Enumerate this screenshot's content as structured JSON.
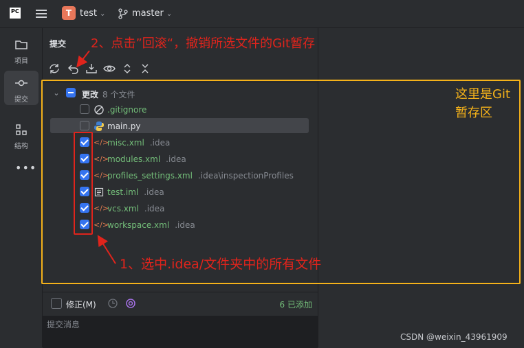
{
  "header": {
    "logo_text": "PC",
    "project_initial": "T",
    "project_name": "test",
    "branch_name": "master"
  },
  "leftbar": {
    "items": [
      {
        "label": "项目"
      },
      {
        "label": "提交"
      },
      {
        "label": "结构"
      }
    ],
    "more": "•••"
  },
  "panel": {
    "title": "提交",
    "group_label": "更改",
    "group_count": "8 个文件",
    "files": [
      {
        "name": ".gitignore",
        "path": "",
        "checked": false,
        "icon": "gitignore-icon"
      },
      {
        "name": "main.py",
        "path": "",
        "checked": false,
        "icon": "python-icon"
      },
      {
        "name": "misc.xml",
        "path": ".idea",
        "checked": true,
        "icon": "xml-icon"
      },
      {
        "name": "modules.xml",
        "path": ".idea",
        "checked": true,
        "icon": "xml-icon"
      },
      {
        "name": "profiles_settings.xml",
        "path": ".idea\\inspectionProfiles",
        "checked": true,
        "icon": "xml-icon"
      },
      {
        "name": "test.iml",
        "path": ".idea",
        "checked": true,
        "icon": "iml-icon"
      },
      {
        "name": "vcs.xml",
        "path": ".idea",
        "checked": true,
        "icon": "xml-icon"
      },
      {
        "name": "workspace.xml",
        "path": ".idea",
        "checked": true,
        "icon": "xml-icon"
      }
    ],
    "amend_label": "修正(M)",
    "added_status": "6 已添加",
    "message_placeholder": "提交消息"
  },
  "annotations": {
    "top_note": "2、点击”回滚“，撤销所选文件的Git暂存",
    "bottom_note": "1、选中.idea/文件夹中的所有文件",
    "side_note_line1": "这里是Git",
    "side_note_line2": "暂存区",
    "watermark": "CSDN @weixin_43961909"
  },
  "colors": {
    "accent": "#3574f0",
    "added_green": "#73bd79",
    "annotation_red": "#e0241c",
    "annotation_yellow": "#f5b21a"
  }
}
